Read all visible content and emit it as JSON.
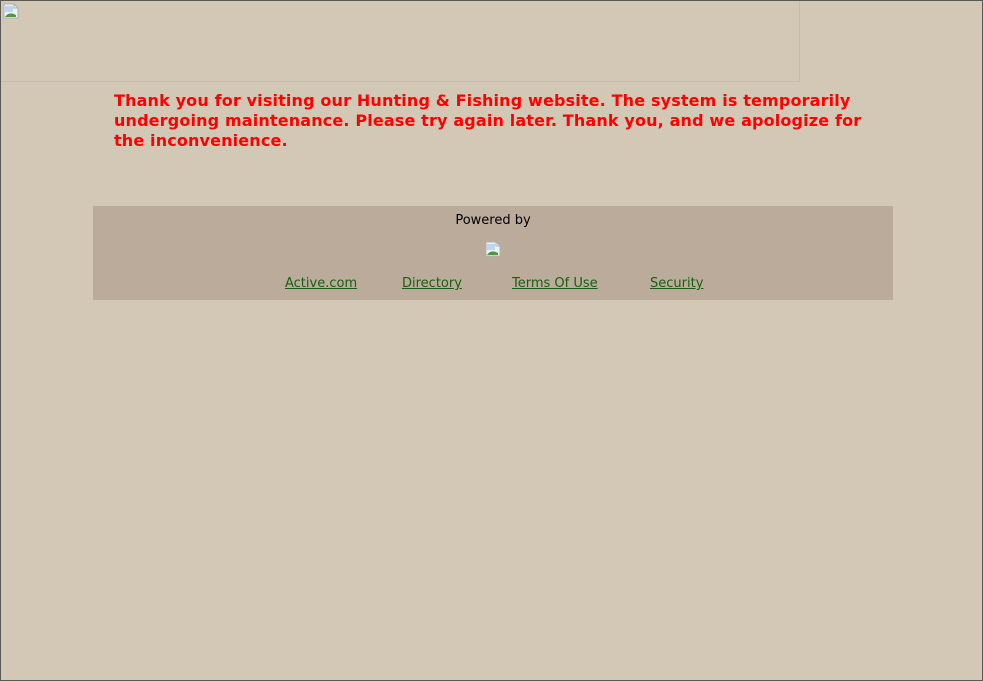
{
  "page": {
    "background_color": "#d3c8b6"
  },
  "banner": {
    "image_icon": "broken-image-icon"
  },
  "message": {
    "text": "Thank you for visiting our Hunting & Fishing website. The system is temporarily undergoing maintenance. Please try again later. Thank you, and we apologize for the inconvenience.",
    "color": "#ff0000"
  },
  "footer": {
    "background_color": "#bbab9a",
    "powered_by_label": "Powered by",
    "logo_icon": "broken-image-icon",
    "links": [
      {
        "label": "Active.com"
      },
      {
        "label": "Directory"
      },
      {
        "label": "Terms Of Use"
      },
      {
        "label": "Security"
      }
    ],
    "link_color": "#16610f"
  }
}
